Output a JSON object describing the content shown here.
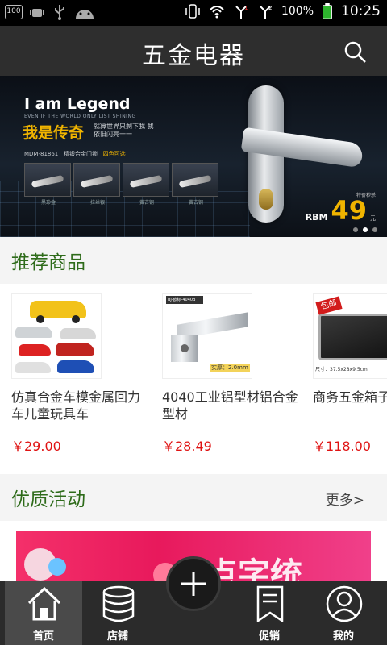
{
  "status_bar": {
    "box_label": "100",
    "battery": "100%",
    "time": "10:25",
    "icons": [
      "android-icon",
      "usb-icon",
      "android-head-icon",
      "vibrate-icon",
      "wifi-icon",
      "signal-icon",
      "signal2-icon",
      "battery-icon"
    ]
  },
  "header": {
    "title": "五金电器",
    "search_icon": "search-icon"
  },
  "banner": {
    "headline": "I am Legend",
    "sub_en": "EVEN IF THE WORLD ONLY LIST SHINING",
    "headline_cn": "我是传奇",
    "sub_cn": "就算世界只剩下我 我依旧闪亮一一",
    "model": "MDM-81861",
    "model_desc": "精锻合金门锁",
    "colors_note": "四色可选",
    "thumb_labels": [
      "黑珍金",
      "拉丝银",
      "黄古铜",
      "黄古铜"
    ],
    "price_note": "特价秒杀",
    "price_currency": "RBM",
    "price_value": "49",
    "price_unit": "元",
    "slide_count": 3,
    "active_slide": 2
  },
  "recommend": {
    "title": "推荐商品",
    "products": [
      {
        "name": "仿真合金车模金属回力车儿童玩具车",
        "price": "￥29.00"
      },
      {
        "name": "4040工业铝型材铝合金型材",
        "price": "￥28.49",
        "img_label": "BJ-欧标-4040B",
        "img_note": "实厚：2.0mm"
      },
      {
        "name": "商务五金箱子金工具箱",
        "price": "￥118.00",
        "img_tag": "包邮",
        "img_size": "尺寸：37.5x28x9.5cm"
      }
    ]
  },
  "activity": {
    "title": "优质活动",
    "more_label": "更多>",
    "banner_text": "点字统"
  },
  "bottom_nav": {
    "items": [
      {
        "label": "首页",
        "icon": "home-icon"
      },
      {
        "label": "店铺",
        "icon": "database-icon"
      },
      {
        "label": "促销",
        "icon": "bookmark-icon"
      },
      {
        "label": "我的",
        "icon": "user-icon"
      }
    ],
    "fab_icon": "plus-icon"
  }
}
